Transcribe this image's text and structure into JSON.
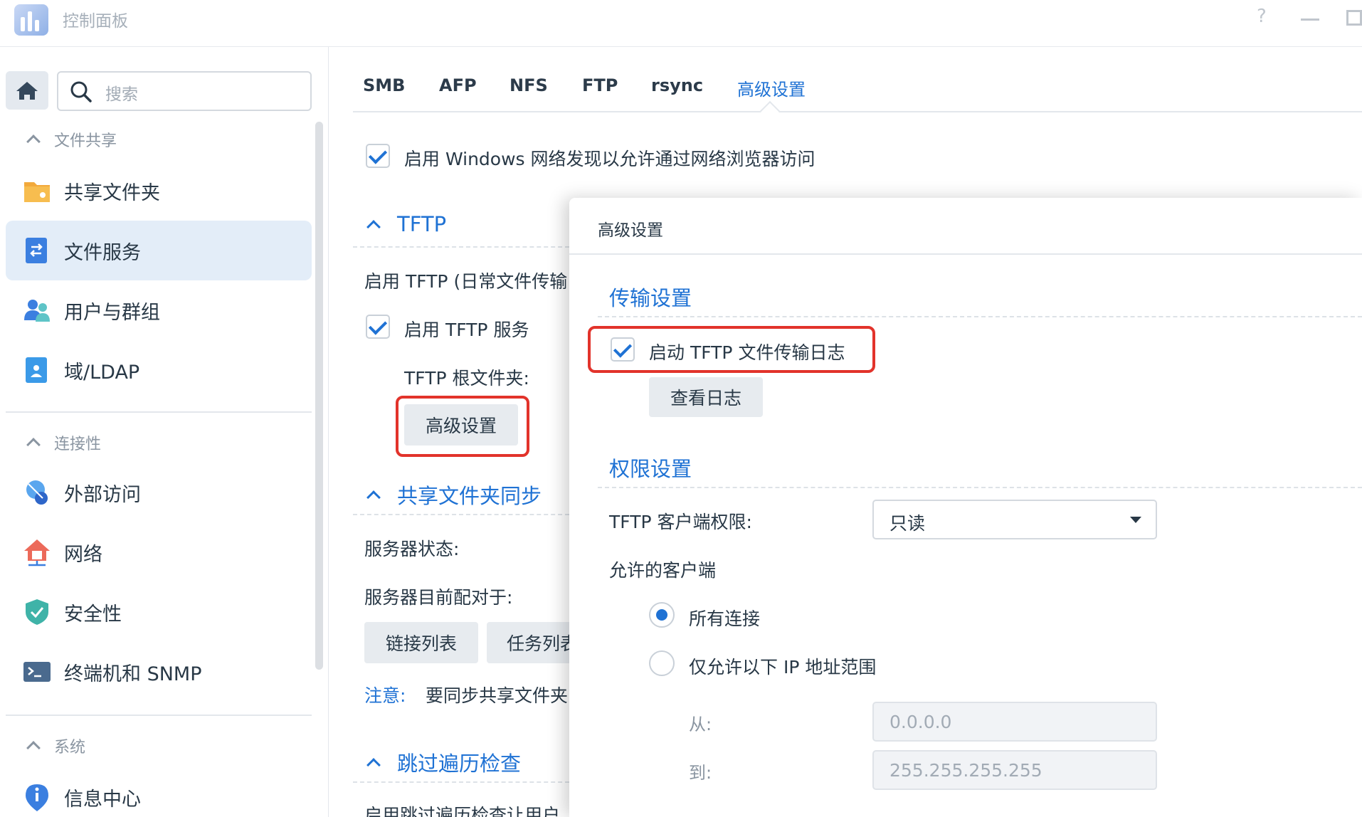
{
  "window": {
    "title": "控制面板"
  },
  "sidebar": {
    "search_placeholder": "搜索",
    "sections": [
      {
        "label": "文件共享",
        "items": [
          {
            "label": "共享文件夹",
            "icon": "folder-icon"
          },
          {
            "label": "文件服务",
            "icon": "file-services-icon",
            "active": true
          },
          {
            "label": "用户与群组",
            "icon": "users-icon"
          },
          {
            "label": "域/LDAP",
            "icon": "domain-icon"
          }
        ]
      },
      {
        "label": "连接性",
        "items": [
          {
            "label": "外部访问",
            "icon": "external-access-icon"
          },
          {
            "label": "网络",
            "icon": "network-icon"
          },
          {
            "label": "安全性",
            "icon": "shield-icon"
          },
          {
            "label": "终端机和 SNMP",
            "icon": "terminal-icon"
          }
        ]
      },
      {
        "label": "系统",
        "items": [
          {
            "label": "信息中心",
            "icon": "info-icon"
          }
        ]
      }
    ]
  },
  "tabs": [
    "SMB",
    "AFP",
    "NFS",
    "FTP",
    "rsync",
    "高级设置"
  ],
  "active_tab": "高级设置",
  "main": {
    "windows_discovery": "启用 Windows 网络发现以允许通过网络浏览器访问",
    "tftp": {
      "title": "TFTP",
      "desc": "启用 TFTP (日常文件传输",
      "enable_label": "启用 TFTP 服务",
      "root_label": "TFTP 根文件夹:",
      "advanced_button": "高级设置"
    },
    "sync": {
      "title": "共享文件夹同步",
      "status_label": "服务器状态:",
      "paired_label": "服务器目前配对于:",
      "link_list_button": "链接列表",
      "task_list_button": "任务列表",
      "note_label": "注意:",
      "note_text": "要同步共享文件夹"
    },
    "traverse": {
      "title": "跳过遍历检查",
      "desc": "启用跳过遍历检查让用户"
    }
  },
  "dialog": {
    "title": "高级设置",
    "transfer_section": "传输设置",
    "enable_log": "启动 TFTP 文件传输日志",
    "view_log_button": "查看日志",
    "permission_section": "权限设置",
    "client_permission_label": "TFTP 客户端权限:",
    "client_permission_value": "只读",
    "allowed_clients_label": "允许的客户端",
    "radio_all": "所有连接",
    "radio_range": "仅允许以下 IP 地址范围",
    "from_label": "从:",
    "from_value": "0.0.0.0",
    "to_label": "到:",
    "to_value": "255.255.255.255"
  },
  "colors": {
    "accent": "#1f72d4",
    "highlight_box": "#e2332b",
    "active_nav_bg": "#e3edf8"
  }
}
